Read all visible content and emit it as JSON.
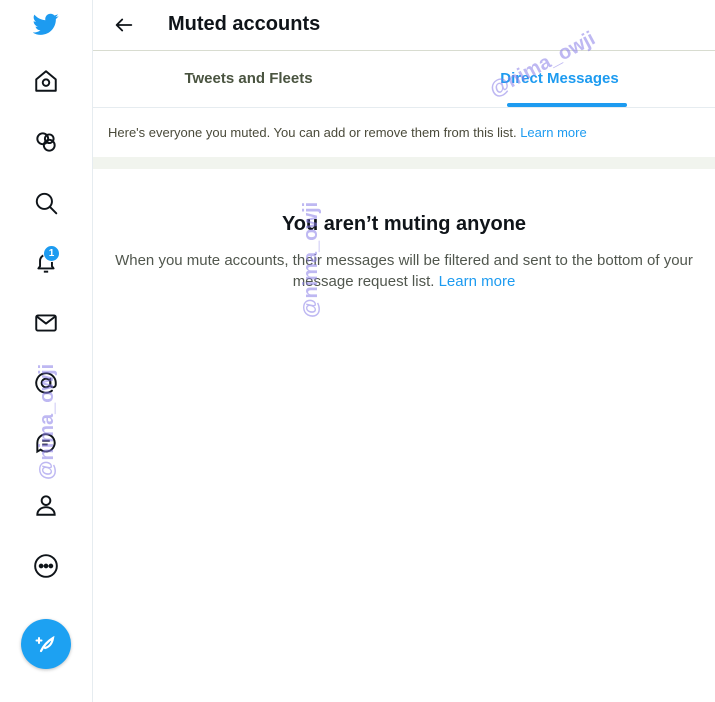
{
  "header": {
    "title": "Muted accounts",
    "back_icon": "arrow-left-icon"
  },
  "tabs": [
    {
      "label": "Tweets and Fleets",
      "active": false
    },
    {
      "label": "Direct Messages",
      "active": true
    }
  ],
  "info": {
    "text": "Here's everyone you muted. You can add or remove them from this list.",
    "link": "Learn more"
  },
  "empty": {
    "title": "You aren’t muting anyone",
    "desc": "When you mute accounts, their messages will be filtered and sent to the bottom of your message request list.",
    "link": "Learn more"
  },
  "sidebar": {
    "items": [
      {
        "icon": "twitter-logo-icon"
      },
      {
        "icon": "home-icon"
      },
      {
        "icon": "communities-icon"
      },
      {
        "icon": "search-icon"
      },
      {
        "icon": "bell-icon",
        "badge": "1"
      },
      {
        "icon": "mail-icon"
      },
      {
        "icon": "at-icon"
      },
      {
        "icon": "lists-icon"
      },
      {
        "icon": "profile-icon"
      },
      {
        "icon": "more-icon"
      }
    ],
    "compose_icon": "compose-tweet-icon"
  },
  "watermark": "@nima_owji",
  "colors": {
    "accent": "#1d9bf0",
    "text": "#0f1419",
    "muted_text": "#51574e"
  }
}
